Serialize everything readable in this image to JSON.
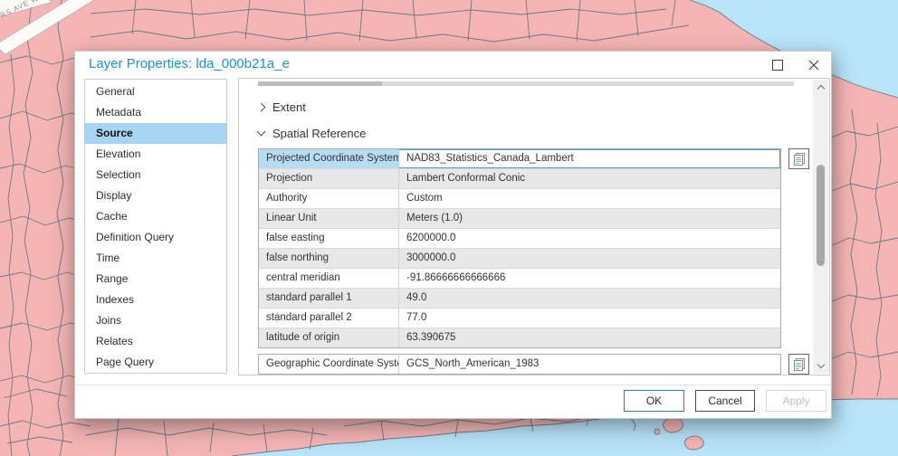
{
  "window": {
    "title": "Layer Properties: lda_000b21a_e"
  },
  "icons": {
    "maximize": "square-outline",
    "close": "x-mark",
    "copy": "copy-pages",
    "section_collapsed": "chevron-right",
    "section_expanded": "chevron-down",
    "scroll_up": "chevron-up",
    "scroll_down": "chevron-down"
  },
  "sidebar": {
    "items": [
      {
        "label": "General",
        "selected": false
      },
      {
        "label": "Metadata",
        "selected": false
      },
      {
        "label": "Source",
        "selected": true
      },
      {
        "label": "Elevation",
        "selected": false
      },
      {
        "label": "Selection",
        "selected": false
      },
      {
        "label": "Display",
        "selected": false
      },
      {
        "label": "Cache",
        "selected": false
      },
      {
        "label": "Definition Query",
        "selected": false
      },
      {
        "label": "Time",
        "selected": false
      },
      {
        "label": "Range",
        "selected": false
      },
      {
        "label": "Indexes",
        "selected": false
      },
      {
        "label": "Joins",
        "selected": false
      },
      {
        "label": "Relates",
        "selected": false
      },
      {
        "label": "Page Query",
        "selected": false
      }
    ]
  },
  "content": {
    "sections": [
      {
        "label": "Extent",
        "state": "collapsed"
      },
      {
        "label": "Spatial Reference",
        "state": "expanded"
      }
    ],
    "projected_table": {
      "rows": [
        {
          "label": "Projected Coordinate System",
          "value": "NAD83_Statistics_Canada_Lambert",
          "selected": true
        },
        {
          "label": "Projection",
          "value": "Lambert Conformal Conic"
        },
        {
          "label": "Authority",
          "value": "Custom"
        },
        {
          "label": "Linear Unit",
          "value": "Meters (1.0)"
        },
        {
          "label": "false easting",
          "value": "6200000.0"
        },
        {
          "label": "false northing",
          "value": "3000000.0"
        },
        {
          "label": "central meridian",
          "value": "-91.86666666666666"
        },
        {
          "label": "standard parallel 1",
          "value": "49.0"
        },
        {
          "label": "standard parallel 2",
          "value": "77.0"
        },
        {
          "label": "latitude of origin",
          "value": "63.390675"
        }
      ]
    },
    "geographic_table": {
      "rows": [
        {
          "label": "Geographic Coordinate System",
          "value": "GCS_North_American_1983"
        }
      ]
    }
  },
  "footer": {
    "ok_label": "OK",
    "cancel_label": "Cancel",
    "apply_label": "Apply",
    "apply_enabled": false
  },
  "map": {
    "road_label": "RS AVE W",
    "colors": {
      "land": "#f5b5b5",
      "water": "#b9e4fa",
      "boundaries": "#6e7984",
      "road": "#fbfbf8"
    }
  }
}
